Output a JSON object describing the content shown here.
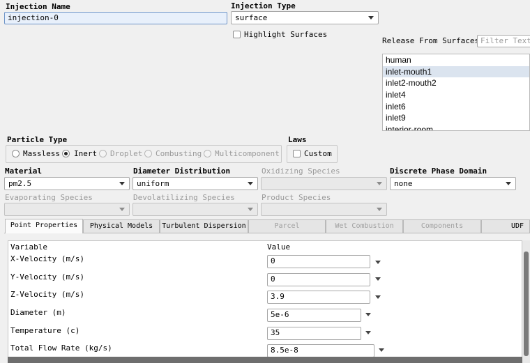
{
  "injection_name": {
    "label": "Injection Name",
    "value": "injection-0"
  },
  "injection_type": {
    "label": "Injection Type",
    "value": "surface"
  },
  "highlight_surfaces": {
    "label": "Highlight Surfaces",
    "checked": false
  },
  "release_from_surfaces": {
    "label": "Release From Surfaces",
    "filter_placeholder": "Filter Text",
    "items": [
      "human",
      "inlet-mouth1",
      "inlet2-mouth2",
      "inlet4",
      "inlet6",
      "inlet9",
      "interior-room"
    ],
    "selected": "inlet-mouth1"
  },
  "particle_type": {
    "label": "Particle Type",
    "options": [
      "Massless",
      "Inert",
      "Droplet",
      "Combusting",
      "Multicomponent"
    ],
    "selected": "Inert"
  },
  "laws": {
    "label": "Laws",
    "custom_label": "Custom",
    "custom_checked": false
  },
  "material": {
    "label": "Material",
    "value": "pm2.5"
  },
  "diameter_distribution": {
    "label": "Diameter Distribution",
    "value": "uniform"
  },
  "oxidizing_species": {
    "label": "Oxidizing Species",
    "value": ""
  },
  "discrete_phase_domain": {
    "label": "Discrete Phase Domain",
    "value": "none"
  },
  "evaporating_species": {
    "label": "Evaporating Species",
    "value": ""
  },
  "devolatilizing_species": {
    "label": "Devolatilizing Species",
    "value": ""
  },
  "product_species": {
    "label": "Product Species",
    "value": ""
  },
  "tabs": [
    "Point Properties",
    "Physical Models",
    "Turbulent Dispersion",
    "Parcel",
    "Wet Combustion",
    "Components",
    "UDF"
  ],
  "active_tab": "Point Properties",
  "properties": {
    "header_variable": "Variable",
    "header_value": "Value",
    "rows": [
      {
        "variable": "X-Velocity (m/s)",
        "value": "0"
      },
      {
        "variable": "Y-Velocity (m/s)",
        "value": "0"
      },
      {
        "variable": "Z-Velocity (m/s)",
        "value": "3.9"
      },
      {
        "variable": "Diameter (m)",
        "value": "5e-6"
      },
      {
        "variable": "Temperature (c)",
        "value": "35"
      },
      {
        "variable": "Total Flow Rate (kg/s)",
        "value": "8.5e-8"
      }
    ]
  },
  "colors": {
    "selection": "#dbe4ef",
    "disabled_text": "#9a9a9a",
    "background": "#f0f0f0"
  }
}
